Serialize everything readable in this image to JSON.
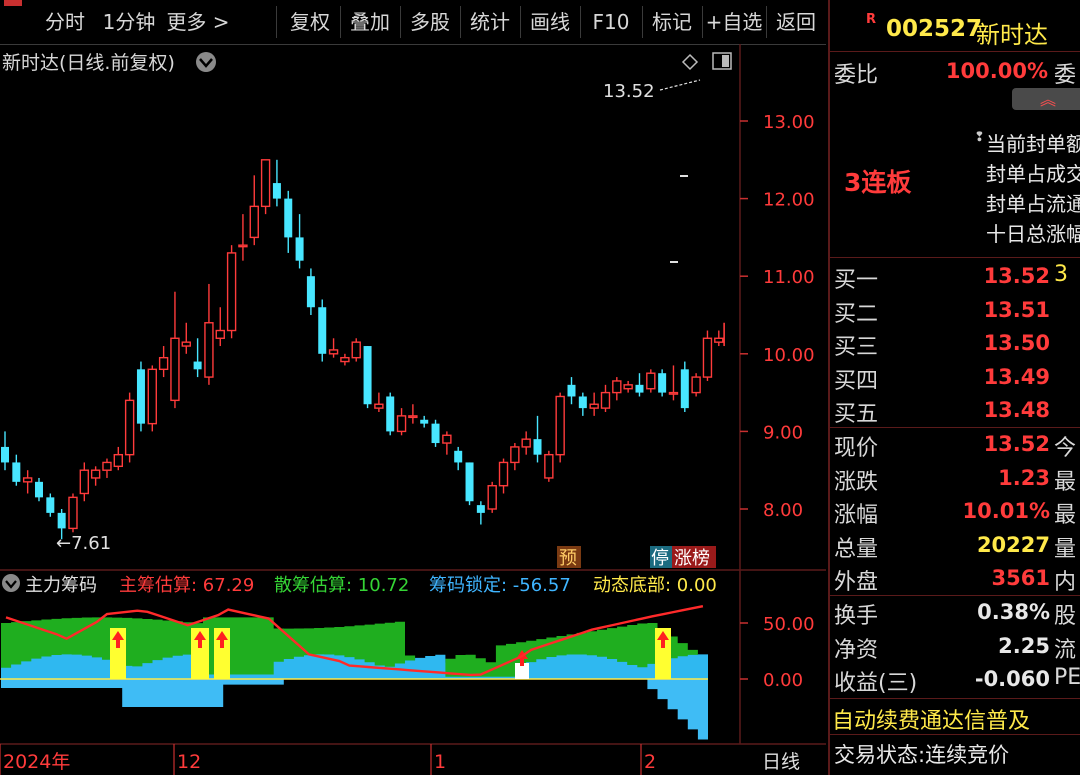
{
  "toolbar": {
    "items": [
      "分时",
      "1分钟",
      "更多 >",
      "复权",
      "叠加",
      "多股",
      "统计",
      "画线",
      "F10",
      "标记",
      "+自选",
      "返回"
    ]
  },
  "chart": {
    "title": "新时达(日线.前复权)",
    "price_axis": [
      "13.00",
      "12.00",
      "11.00",
      "10.00",
      "9.00",
      "8.00"
    ],
    "high_label": "13.52",
    "low_label": "7.61",
    "markers": {
      "pre": "预",
      "stop": "停",
      "limit_list": "涨榜"
    },
    "date_labels": [
      "2024年",
      "12",
      "1",
      "2"
    ],
    "period": "日线"
  },
  "indicator": {
    "name": "主力筹码",
    "items": [
      {
        "label": "主筹估算: 67.29",
        "color": "#ff3b3b"
      },
      {
        "label": "散筹估算: 10.72",
        "color": "#35d435"
      },
      {
        "label": "筹码锁定: -56.57",
        "color": "#3fb5ff"
      },
      {
        "label": "动态底部: 0.00",
        "color": "#ffe94a"
      }
    ],
    "axis": [
      "50.00",
      "0.00"
    ]
  },
  "chart_data": {
    "type": "candlestick",
    "title": "新时达(日线.前复权)",
    "ylim": [
      7.4,
      13.8
    ],
    "candles": [
      {
        "o": 8.8,
        "c": 8.6,
        "h": 9.0,
        "l": 8.5
      },
      {
        "o": 8.6,
        "c": 8.35,
        "h": 8.7,
        "l": 8.3
      },
      {
        "o": 8.35,
        "c": 8.4,
        "h": 8.5,
        "l": 8.2
      },
      {
        "o": 8.35,
        "c": 8.15,
        "h": 8.4,
        "l": 8.1
      },
      {
        "o": 8.15,
        "c": 7.95,
        "h": 8.2,
        "l": 7.9
      },
      {
        "o": 7.95,
        "c": 7.75,
        "h": 8.0,
        "l": 7.61
      },
      {
        "o": 7.75,
        "c": 8.15,
        "h": 8.2,
        "l": 7.7
      },
      {
        "o": 8.2,
        "c": 8.5,
        "h": 8.6,
        "l": 8.1
      },
      {
        "o": 8.4,
        "c": 8.5,
        "h": 8.55,
        "l": 8.3
      },
      {
        "o": 8.5,
        "c": 8.6,
        "h": 8.65,
        "l": 8.4
      },
      {
        "o": 8.55,
        "c": 8.7,
        "h": 8.8,
        "l": 8.5
      },
      {
        "o": 8.7,
        "c": 9.4,
        "h": 9.5,
        "l": 8.6
      },
      {
        "o": 9.8,
        "c": 9.1,
        "h": 9.9,
        "l": 9.0
      },
      {
        "o": 9.1,
        "c": 9.8,
        "h": 9.85,
        "l": 9.0
      },
      {
        "o": 9.8,
        "c": 9.95,
        "h": 10.1,
        "l": 9.7
      },
      {
        "o": 9.4,
        "c": 10.2,
        "h": 10.8,
        "l": 9.3
      },
      {
        "o": 10.1,
        "c": 10.15,
        "h": 10.4,
        "l": 10.0
      },
      {
        "o": 9.9,
        "c": 9.8,
        "h": 10.2,
        "l": 9.7
      },
      {
        "o": 9.7,
        "c": 10.4,
        "h": 10.9,
        "l": 9.6
      },
      {
        "o": 10.2,
        "c": 10.3,
        "h": 10.6,
        "l": 10.1
      },
      {
        "o": 10.3,
        "c": 11.3,
        "h": 11.4,
        "l": 10.2
      },
      {
        "o": 11.4,
        "c": 11.4,
        "h": 11.8,
        "l": 11.2
      },
      {
        "o": 11.5,
        "c": 11.9,
        "h": 12.3,
        "l": 11.4
      },
      {
        "o": 11.9,
        "c": 12.5,
        "h": 12.5,
        "l": 11.8
      },
      {
        "o": 12.2,
        "c": 12.0,
        "h": 12.5,
        "l": 11.9
      },
      {
        "o": 12.0,
        "c": 11.5,
        "h": 12.1,
        "l": 11.3
      },
      {
        "o": 11.5,
        "c": 11.2,
        "h": 11.8,
        "l": 11.1
      },
      {
        "o": 11.0,
        "c": 10.6,
        "h": 11.1,
        "l": 10.5
      },
      {
        "o": 10.6,
        "c": 10.0,
        "h": 10.7,
        "l": 9.9
      },
      {
        "o": 10.0,
        "c": 10.05,
        "h": 10.2,
        "l": 9.95
      },
      {
        "o": 9.9,
        "c": 9.95,
        "h": 10.0,
        "l": 9.85
      },
      {
        "o": 9.95,
        "c": 10.15,
        "h": 10.2,
        "l": 9.9
      },
      {
        "o": 10.1,
        "c": 9.35,
        "h": 10.1,
        "l": 9.3
      },
      {
        "o": 9.3,
        "c": 9.35,
        "h": 9.5,
        "l": 9.25
      },
      {
        "o": 9.45,
        "c": 9.0,
        "h": 9.5,
        "l": 8.95
      },
      {
        "o": 9.0,
        "c": 9.2,
        "h": 9.3,
        "l": 8.95
      },
      {
        "o": 9.2,
        "c": 9.2,
        "h": 9.35,
        "l": 9.1
      },
      {
        "o": 9.15,
        "c": 9.1,
        "h": 9.2,
        "l": 9.05
      },
      {
        "o": 9.1,
        "c": 8.85,
        "h": 9.15,
        "l": 8.8
      },
      {
        "o": 8.85,
        "c": 8.95,
        "h": 9.0,
        "l": 8.7
      },
      {
        "o": 8.75,
        "c": 8.6,
        "h": 8.8,
        "l": 8.5
      },
      {
        "o": 8.6,
        "c": 8.1,
        "h": 8.6,
        "l": 8.05
      },
      {
        "o": 8.05,
        "c": 7.95,
        "h": 8.1,
        "l": 7.8
      },
      {
        "o": 8.0,
        "c": 8.3,
        "h": 8.35,
        "l": 7.95
      },
      {
        "o": 8.3,
        "c": 8.6,
        "h": 8.65,
        "l": 8.2
      },
      {
        "o": 8.6,
        "c": 8.8,
        "h": 8.85,
        "l": 8.5
      },
      {
        "o": 8.8,
        "c": 8.9,
        "h": 9.0,
        "l": 8.7
      },
      {
        "o": 8.9,
        "c": 8.7,
        "h": 9.2,
        "l": 8.6
      },
      {
        "o": 8.4,
        "c": 8.7,
        "h": 8.75,
        "l": 8.35
      },
      {
        "o": 8.7,
        "c": 9.45,
        "h": 9.5,
        "l": 8.6
      },
      {
        "o": 9.6,
        "c": 9.45,
        "h": 9.7,
        "l": 9.35
      },
      {
        "o": 9.45,
        "c": 9.3,
        "h": 9.5,
        "l": 9.2
      },
      {
        "o": 9.3,
        "c": 9.35,
        "h": 9.5,
        "l": 9.2
      },
      {
        "o": 9.3,
        "c": 9.5,
        "h": 9.6,
        "l": 9.25
      },
      {
        "o": 9.5,
        "c": 9.65,
        "h": 9.7,
        "l": 9.4
      },
      {
        "o": 9.55,
        "c": 9.6,
        "h": 9.65,
        "l": 9.5
      },
      {
        "o": 9.6,
        "c": 9.5,
        "h": 9.75,
        "l": 9.45
      },
      {
        "o": 9.55,
        "c": 9.75,
        "h": 9.8,
        "l": 9.5
      },
      {
        "o": 9.75,
        "c": 9.5,
        "h": 9.8,
        "l": 9.45
      },
      {
        "o": 9.5,
        "c": 9.5,
        "h": 9.85,
        "l": 9.4
      },
      {
        "o": 9.8,
        "c": 9.3,
        "h": 9.9,
        "l": 9.25
      },
      {
        "o": 9.5,
        "c": 9.7,
        "h": 9.75,
        "l": 9.45
      },
      {
        "o": 9.7,
        "c": 10.2,
        "h": 10.3,
        "l": 9.65
      },
      {
        "o": 10.15,
        "c": 10.2,
        "h": 10.3,
        "l": 10.1
      }
    ]
  },
  "right": {
    "badge": "R",
    "code": "002527",
    "name": "新时达",
    "webi_label": "委比",
    "webi_value": "100.00%",
    "webi_tail": "委",
    "limit_board": "3连板",
    "info_lines": [
      "当前封单额",
      "封单占成交",
      "封单占流通",
      "十日总涨幅"
    ],
    "bids": [
      {
        "label": "买一",
        "price": "13.52",
        "tail": "3"
      },
      {
        "label": "买二",
        "price": "13.51",
        "tail": ""
      },
      {
        "label": "买三",
        "price": "13.50",
        "tail": ""
      },
      {
        "label": "买四",
        "price": "13.49",
        "tail": ""
      },
      {
        "label": "买五",
        "price": "13.48",
        "tail": ""
      }
    ],
    "quote": [
      {
        "label": "现价",
        "value": "13.52",
        "tail": "今",
        "color": "red"
      },
      {
        "label": "涨跌",
        "value": "1.23",
        "tail": "最",
        "color": "red"
      },
      {
        "label": "涨幅",
        "value": "10.01%",
        "tail": "最",
        "color": "red"
      },
      {
        "label": "总量",
        "value": "20227",
        "tail": "量",
        "color": "yellow"
      },
      {
        "label": "外盘",
        "value": "3561",
        "tail": "内",
        "color": "red"
      }
    ],
    "stats": [
      {
        "label": "换手",
        "value": "0.38%",
        "tail": "股",
        "color": "white"
      },
      {
        "label": "净资",
        "value": "2.25",
        "tail": "流",
        "color": "white"
      },
      {
        "label": "收益(三)",
        "value": "-0.060",
        "tail": "PE",
        "color": "white"
      }
    ],
    "ad": "自动续费通达信普及",
    "status_label": "交易状态:",
    "status_value": "连续竞价"
  },
  "colors": {
    "up": "#ff3b3b",
    "down": "#48e6ff",
    "grid": "#5a1a1a",
    "green": "#1fae1f",
    "cyan": "#2fb8f0"
  }
}
